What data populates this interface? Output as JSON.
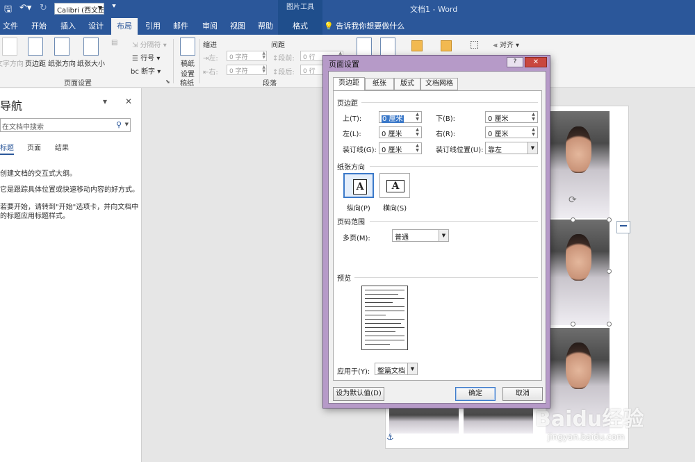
{
  "titlebar": {
    "save_icon": "save-icon",
    "undo_icon": "undo-icon",
    "redo_icon": "redo-icon",
    "font_name": "Calibri (西文正",
    "customize_icon": "customize-qat-icon",
    "context_header": "图片工具",
    "doc_title": "文档1 - Word",
    "colors": {
      "primary": "#2b579a",
      "context": "#1f4e8c"
    }
  },
  "tabs": [
    {
      "label": "文件"
    },
    {
      "label": "开始"
    },
    {
      "label": "插入"
    },
    {
      "label": "设计"
    },
    {
      "label": "布局",
      "active": true
    },
    {
      "label": "引用"
    },
    {
      "label": "邮件"
    },
    {
      "label": "审阅"
    },
    {
      "label": "视图"
    },
    {
      "label": "帮助"
    },
    {
      "label": "格式",
      "context": true
    }
  ],
  "tell_me": "告诉我你想要做什么",
  "ribbon": {
    "text_direction": "文字方向",
    "margins": "页边距",
    "orientation": "纸张方向",
    "size": "纸张大小",
    "breaks": "分隔符",
    "line_numbers": "行号",
    "hyphenation": "断字",
    "page_setup_group": "页面设置",
    "draft_label_1": "稿纸",
    "draft_label_2": "设置",
    "draft_group": "稿纸",
    "indent_header": "缩进",
    "spacing_header": "间距",
    "indent_left_label": "左:",
    "indent_right_label": "右:",
    "indent_left_value": "0 字符",
    "indent_right_value": "0 字符",
    "spacing_before_label": "段前:",
    "spacing_after_label": "段后:",
    "spacing_before_value": "0 行",
    "spacing_after_value": "0 行",
    "paragraph_group": "段落",
    "align": "对齐"
  },
  "nav": {
    "title": "导航",
    "search_placeholder": "在文档中搜索",
    "tabs": [
      "标题",
      "页面",
      "结果"
    ],
    "lines": [
      "创建文档的交互式大纲。",
      "它是跟踪具体位置或快速移动内容的好方式。",
      "若要开始，请转到\"开始\"选项卡，并向文档中",
      "的标题应用标题样式。"
    ]
  },
  "watermark": {
    "brand": "Baidu经验",
    "url": "jingyan.baidu.com"
  },
  "dialog": {
    "title": "页面设置",
    "help": "?",
    "close": "✕",
    "tabs": [
      "页边距",
      "纸张",
      "版式",
      "文档网格"
    ],
    "margins_section": "页边距",
    "top_label": "上(T):",
    "top_value": "0 厘米",
    "bottom_label": "下(B):",
    "bottom_value": "0 厘米",
    "left_label": "左(L):",
    "left_value": "0 厘米",
    "right_label": "右(R):",
    "right_value": "0 厘米",
    "gutter_label": "装订线(G):",
    "gutter_value": "0 厘米",
    "gutter_pos_label": "装订线位置(U):",
    "gutter_pos_value": "靠左",
    "orientation_section": "纸张方向",
    "portrait": "纵向(P)",
    "landscape": "横向(S)",
    "pages_section": "页码范围",
    "multiple_pages_label": "多页(M):",
    "multiple_pages_value": "普通",
    "preview_section": "预览",
    "apply_to_label": "应用于(Y):",
    "apply_to_value": "整篇文档",
    "set_default": "设为默认值(D)",
    "ok": "确定",
    "cancel": "取消"
  }
}
